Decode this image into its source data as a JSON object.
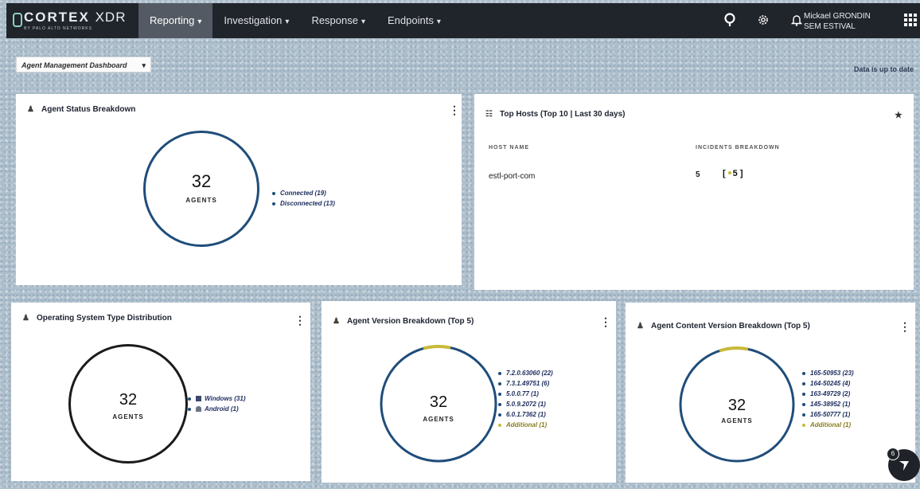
{
  "topbar": {
    "logo_main": "CORTEX",
    "logo_xdr": "XDR",
    "logo_sub": "BY PALO ALTO NETWORKS",
    "nav": [
      {
        "label": "Reporting",
        "active": true
      },
      {
        "label": "Investigation",
        "active": false
      },
      {
        "label": "Response",
        "active": false
      },
      {
        "label": "Endpoints",
        "active": false
      }
    ],
    "caret": "▾",
    "icons": [
      "search-icon",
      "gear-icon",
      "bell-icon",
      "apps-grid-icon"
    ],
    "user_name": "Mickael GRONDIN",
    "user_org": "SEM ESTIVAL"
  },
  "dashboard": {
    "selected": "Agent Management Dashboard",
    "status": "Data is up to date"
  },
  "agent_status": {
    "title": "Agent Status Breakdown",
    "total": "32",
    "total_label": "AGENTS",
    "legend": [
      "Connected (19)",
      "Disconnected (13)"
    ]
  },
  "top_hosts": {
    "title": "Top Hosts (Top 10 | Last 30 days)",
    "col_host": "HOST NAME",
    "col_incidents": "INCIDENTS BREAKDOWN",
    "rows": [
      {
        "host": "estl-port-com",
        "count": "5",
        "breakdown": "5"
      }
    ]
  },
  "os_dist": {
    "title": "Operating System Type Distribution",
    "total": "32",
    "total_label": "AGENTS",
    "legend": [
      "Windows (31)",
      "Android (1)"
    ]
  },
  "agent_version": {
    "title": "Agent Version Breakdown (Top 5)",
    "total": "32",
    "total_label": "AGENTS",
    "legend": [
      "7.2.0.63060 (22)",
      "7.3.1.49751 (6)",
      "5.0.0.77 (1)",
      "5.0.9.2072 (1)",
      "6.0.1.7362 (1)",
      "Additional (1)"
    ]
  },
  "content_version": {
    "title": "Agent Content Version Breakdown (Top 5)",
    "total": "32",
    "total_label": "AGENTS",
    "legend": [
      "165-50953 (23)",
      "164-50245 (4)",
      "163-49729 (2)",
      "145-38952 (1)",
      "165-50777 (1)",
      "Additional (1)"
    ]
  },
  "colors": {
    "topbar": "#20242b",
    "nav_active": "#545a63",
    "donut_blue": "#1f4d7a",
    "donut_dark": "#1b1b1b",
    "additional": "#c9b93a"
  },
  "help_badge": "6"
}
